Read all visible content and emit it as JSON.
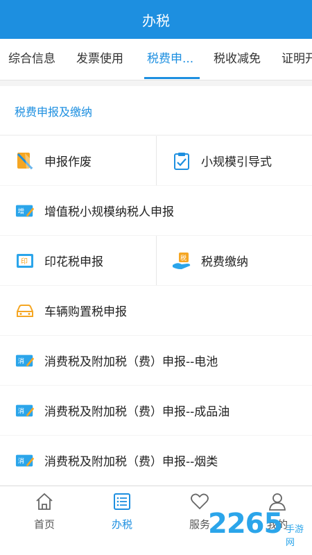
{
  "header": {
    "title": "办税"
  },
  "tabs": [
    {
      "label": "综合信息",
      "active": false
    },
    {
      "label": "发票使用",
      "active": false
    },
    {
      "label": "税费申...",
      "active": true
    },
    {
      "label": "税收减免",
      "active": false
    },
    {
      "label": "证明开",
      "active": false
    }
  ],
  "section": {
    "title": "税费申报及缴纳"
  },
  "items": [
    {
      "label": "申报作废",
      "icon": "void-declaration-icon"
    },
    {
      "label": "小规模引导式",
      "icon": "clipboard-check-icon"
    },
    {
      "label": "增值税小规模纳税人申报",
      "icon": "vat-ticket-icon",
      "badge": "增"
    },
    {
      "label": "印花税申报",
      "icon": "stamp-icon",
      "badge": "印"
    },
    {
      "label": "税费缴纳",
      "icon": "hand-payment-icon",
      "badge": "税"
    },
    {
      "label": "车辆购置税申报",
      "icon": "car-icon"
    },
    {
      "label": "消费税及附加税（费）申报--电池",
      "icon": "consumption-tax-icon",
      "badge": "消"
    },
    {
      "label": "消费税及附加税（费）申报--成品油",
      "icon": "consumption-tax-icon",
      "badge": "消"
    },
    {
      "label": "消费税及附加税（费）申报--烟类",
      "icon": "consumption-tax-icon",
      "badge": "消"
    }
  ],
  "nav": [
    {
      "label": "首页",
      "icon": "home-icon",
      "active": false
    },
    {
      "label": "办税",
      "icon": "list-icon",
      "active": true
    },
    {
      "label": "服务",
      "icon": "heart-icon",
      "active": false
    },
    {
      "label": "我的",
      "icon": "user-icon",
      "active": false
    }
  ],
  "watermark": {
    "number": "2265",
    "text": "手游网"
  },
  "colors": {
    "primary": "#1d8fe0",
    "orange": "#f5a623",
    "watermark": "#2ba5ea"
  }
}
